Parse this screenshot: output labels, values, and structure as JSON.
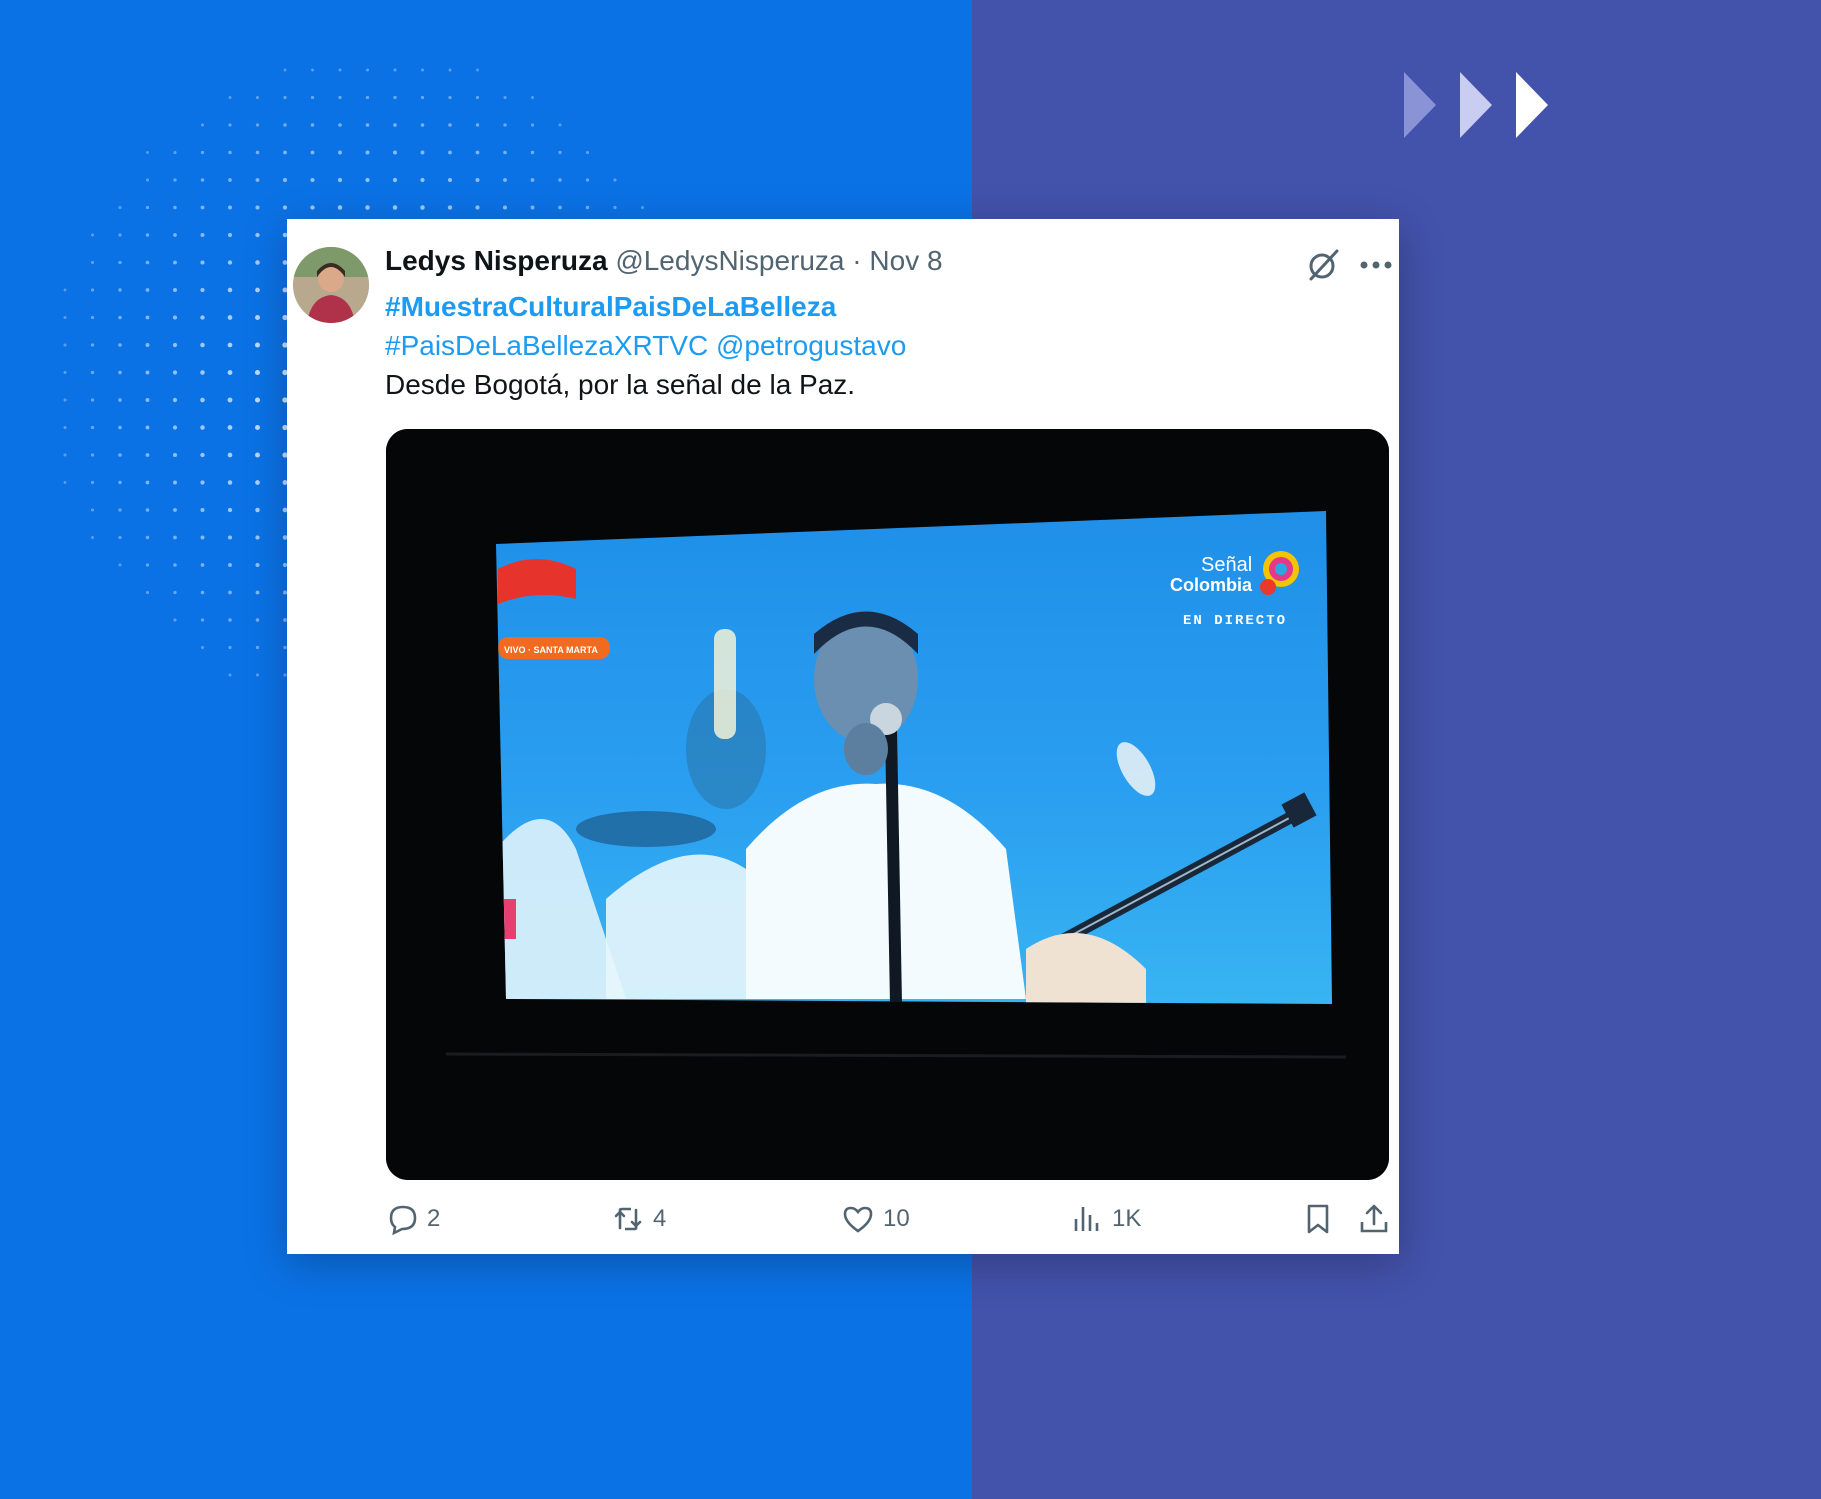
{
  "tweet": {
    "author_name": "Ledys Nisperuza",
    "handle": "@LedysNisperuza",
    "separator": "·",
    "date": "Nov 8",
    "hashtag_main": "#MuestraCulturalPaisDeLaBelleza",
    "hashtag_second": "#PaisDeLaBellezaXRTVC",
    "mention": "@petrogustavo",
    "text": "Desde Bogotá, por la señal de la Paz."
  },
  "media": {
    "channel_line1": "Señal",
    "channel_line2": "Colombia",
    "live_label": "EN DIRECTO",
    "lower_tag": "VIVO · SANTA MARTA"
  },
  "actions": {
    "replies": "2",
    "retweets": "4",
    "likes": "10",
    "views": "1K"
  },
  "colors": {
    "bg_left": "#0b72e6",
    "bg_right": "#4352ab",
    "link": "#1d9bf0",
    "muted": "#536471"
  }
}
